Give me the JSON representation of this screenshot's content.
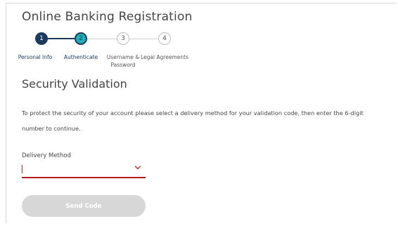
{
  "page": {
    "title": "Online Banking Registration"
  },
  "stepper": {
    "steps": [
      {
        "number": "1",
        "label": "Personal Info",
        "state": "completed"
      },
      {
        "number": "2",
        "label": "Authenticate",
        "state": "current"
      },
      {
        "number": "3",
        "label": "Username & Password",
        "state": "pending"
      },
      {
        "number": "4",
        "label": "Legal Agreements",
        "state": "pending"
      }
    ]
  },
  "security": {
    "title": "Security Validation",
    "instructions": "To protect the security of your account please select a delivery method for your validation code, then enter the 6-digit number to continue."
  },
  "delivery": {
    "label": "Delivery Method",
    "selected_value": ""
  },
  "send_button": {
    "label": "Send Code"
  },
  "colors": {
    "navy": "#1b3a5e",
    "teal": "#1fb0b6",
    "error_red": "#b71c1c",
    "disabled_gray": "#d7d7d7"
  },
  "icons": {
    "select_toggle": "chevron-down-icon"
  }
}
